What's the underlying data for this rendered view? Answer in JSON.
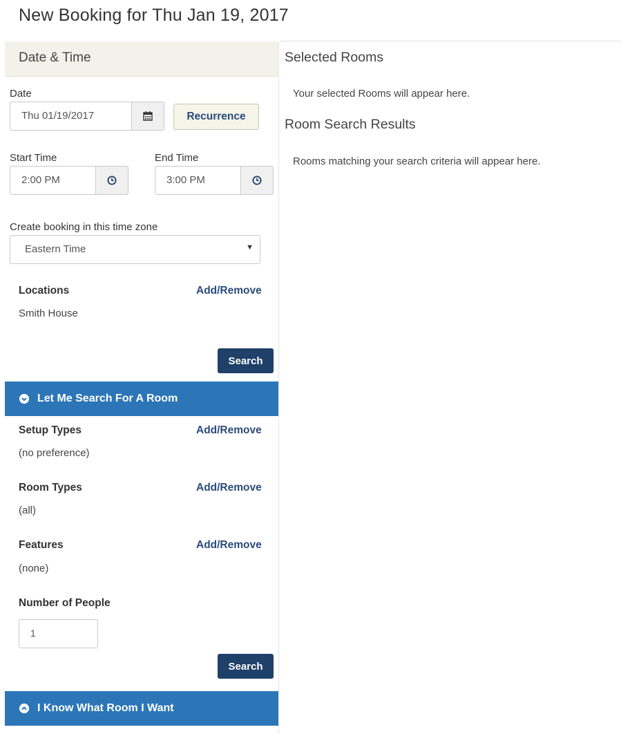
{
  "page": {
    "title": "New Booking for Thu Jan 19, 2017"
  },
  "date_time": {
    "header": "Date & Time",
    "date_label": "Date",
    "date_value": "Thu 01/19/2017",
    "recurrence_label": "Recurrence",
    "start_label": "Start Time",
    "start_value": "2:00 PM",
    "end_label": "End Time",
    "end_value": "3:00 PM",
    "timezone_label": "Create booking in this time zone",
    "timezone_value": "Eastern Time",
    "locations_label": "Locations",
    "locations_link": "Add/Remove",
    "locations_value": "Smith House",
    "search_label": "Search"
  },
  "search_room": {
    "header": "Let Me Search For A Room",
    "setup_label": "Setup Types",
    "setup_link": "Add/Remove",
    "setup_value": "(no preference)",
    "room_types_label": "Room Types",
    "room_types_link": "Add/Remove",
    "room_types_value": "(all)",
    "features_label": "Features",
    "features_link": "Add/Remove",
    "features_value": "(none)",
    "people_label": "Number of People",
    "people_value": "1",
    "search_label": "Search"
  },
  "know_room": {
    "header": "I Know What Room I Want"
  },
  "right": {
    "selected_header": "Selected Rooms",
    "selected_text": "Your selected Rooms will appear here.",
    "results_header": "Room Search Results",
    "results_text": "Rooms matching your search criteria will appear here."
  },
  "icons": {
    "calendar": "calendar-icon",
    "clock": "clock-icon",
    "chevron_down_circle": "chevron-down-circle-icon",
    "chevron_up_circle": "chevron-up-circle-icon"
  },
  "colors": {
    "accordion": "#2c76b8",
    "dark_button": "#1f4068",
    "link": "#2b4a7a",
    "panel_header": "#f2f2ea"
  }
}
